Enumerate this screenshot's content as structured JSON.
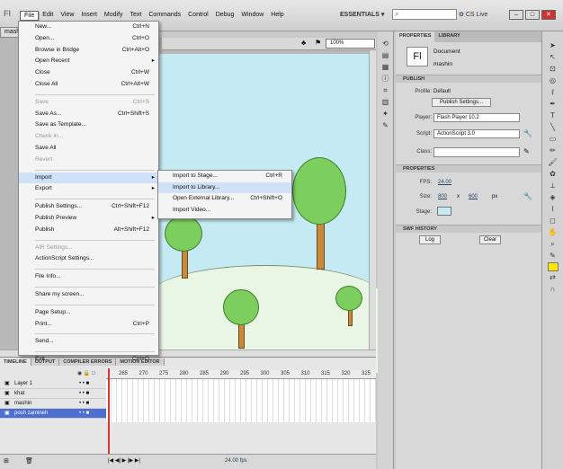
{
  "app": {
    "logo": "Fl"
  },
  "menubar": {
    "items": [
      "File",
      "Edit",
      "View",
      "Insert",
      "Modify",
      "Text",
      "Commands",
      "Control",
      "Debug",
      "Window",
      "Help"
    ],
    "workspace": "ESSENTIALS ▾",
    "search_placeholder": "",
    "cslive": "CS Live",
    "search_icon": "magnifier-icon"
  },
  "document": {
    "tab": "mashi"
  },
  "stage": {
    "zoom": "100%",
    "background": "#c4ebf3"
  },
  "file_menu": {
    "items": [
      {
        "label": "New...",
        "shortcut": "Ctrl+N",
        "enabled": true
      },
      {
        "label": "Open...",
        "shortcut": "Ctrl+O",
        "enabled": true
      },
      {
        "label": "Browse in Bridge",
        "shortcut": "Ctrl+Alt+O",
        "enabled": true
      },
      {
        "label": "Open Recent",
        "shortcut": "",
        "enabled": true,
        "submenu": true
      },
      {
        "label": "Close",
        "shortcut": "Ctrl+W",
        "enabled": true
      },
      {
        "label": "Close All",
        "shortcut": "Ctrl+Alt+W",
        "enabled": true
      },
      {
        "label": "Save",
        "shortcut": "Ctrl+S",
        "enabled": false
      },
      {
        "label": "Save As...",
        "shortcut": "Ctrl+Shift+S",
        "enabled": true
      },
      {
        "label": "Save as Template...",
        "shortcut": "",
        "enabled": true
      },
      {
        "label": "Check In...",
        "shortcut": "",
        "enabled": false
      },
      {
        "label": "Save All",
        "shortcut": "",
        "enabled": true
      },
      {
        "label": "Revert",
        "shortcut": "",
        "enabled": false
      },
      {
        "label": "Import",
        "shortcut": "",
        "enabled": true,
        "submenu": true,
        "highlighted": true
      },
      {
        "label": "Export",
        "shortcut": "",
        "enabled": true,
        "submenu": true
      },
      {
        "label": "Publish Settings...",
        "shortcut": "Ctrl+Shift+F12",
        "enabled": true
      },
      {
        "label": "Publish Preview",
        "shortcut": "",
        "enabled": true,
        "submenu": true
      },
      {
        "label": "Publish",
        "shortcut": "Alt+Shift+F12",
        "enabled": true
      },
      {
        "label": "AIR Settings...",
        "shortcut": "",
        "enabled": false
      },
      {
        "label": "ActionScript Settings...",
        "shortcut": "",
        "enabled": true
      },
      {
        "label": "File Info...",
        "shortcut": "",
        "enabled": true
      },
      {
        "label": "Share my screen...",
        "shortcut": "",
        "enabled": true
      },
      {
        "label": "Page Setup...",
        "shortcut": "",
        "enabled": true
      },
      {
        "label": "Print...",
        "shortcut": "Ctrl+P",
        "enabled": true
      },
      {
        "label": "Send...",
        "shortcut": "",
        "enabled": true
      },
      {
        "label": "Exit",
        "shortcut": "Ctrl+Q",
        "enabled": true
      }
    ]
  },
  "import_submenu": {
    "items": [
      {
        "label": "Import to Stage...",
        "shortcut": "Ctrl+R"
      },
      {
        "label": "Import to Library...",
        "shortcut": "",
        "highlighted": true
      },
      {
        "label": "Open External Library...",
        "shortcut": "Ctrl+Shift+O"
      },
      {
        "label": "Import Video...",
        "shortcut": ""
      }
    ]
  },
  "timeline": {
    "tabs": [
      "TIMELINE",
      "OUTPUT",
      "COMPILER ERRORS",
      "MOTION EDITOR"
    ],
    "ruler": [
      "265",
      "270",
      "275",
      "280",
      "285",
      "290",
      "295",
      "300",
      "305",
      "310",
      "315",
      "320",
      "325"
    ],
    "layers": [
      {
        "name": "Layer 1",
        "selected": false
      },
      {
        "name": "khat",
        "selected": false
      },
      {
        "name": "mashin",
        "selected": false
      },
      {
        "name": "posh zamineh",
        "selected": true
      }
    ],
    "status": "24.00 fps"
  },
  "properties": {
    "tabs": [
      "PROPERTIES",
      "LIBRARY"
    ],
    "doc_icon": "Fl",
    "doc_type": "Document",
    "doc_name": "mashin",
    "publish_header": "PUBLISH",
    "profile_label": "Profile:",
    "profile_value": "Default",
    "publish_settings_btn": "Publish Settings...",
    "player_label": "Player:",
    "player_value": "Flash Player 10.2",
    "script_label": "Script:",
    "script_value": "ActionScript 3.0",
    "class_label": "Class:",
    "class_value": "",
    "props_header": "PROPERTIES",
    "fps_label": "FPS:",
    "fps_value": "24.00",
    "size_label": "Size:",
    "width_value": "800",
    "x_label": "x",
    "height_value": "600",
    "px_label": "px",
    "stage_label": "Stage:",
    "stage_color": "#c4ebf3",
    "swf_header": "SWF HISTORY",
    "log_btn": "Log",
    "clear_btn": "Clear"
  }
}
